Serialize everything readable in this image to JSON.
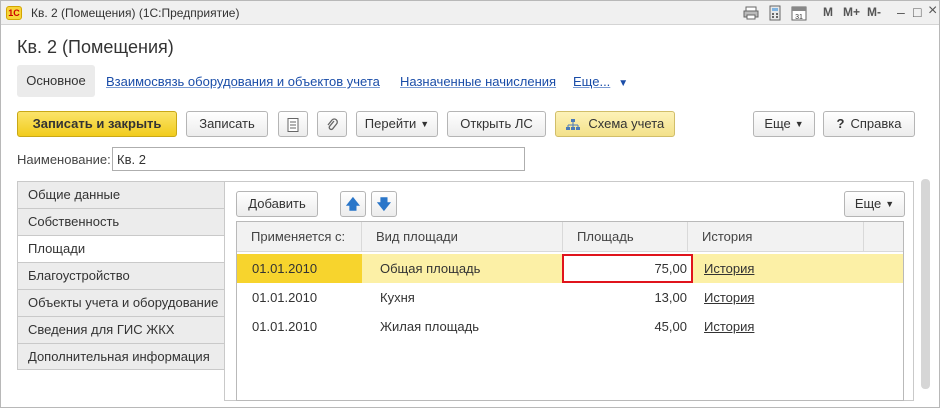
{
  "titlebar": {
    "app_logo": "1С",
    "title": "Кв. 2 (Помещения)  (1С:Предприятие)",
    "icons": [
      "print-icon",
      "calculator-icon",
      "calendar-icon"
    ],
    "calendar_day": "31",
    "m_label": "M",
    "mplus_label": "M+",
    "mminus_label": "M-",
    "minimize_glyph": "–",
    "maximize_glyph": "□",
    "close_glyph": "×"
  },
  "form": {
    "title": "Кв. 2 (Помещения)"
  },
  "nav": {
    "active": "Основное",
    "links": [
      "Взаимосвязь оборудования и объектов учета",
      "Назначенные начисления",
      "Еще..."
    ]
  },
  "toolbar": {
    "save_close": "Записать и закрыть",
    "save": "Записать",
    "goto": "Перейти",
    "open_ls": "Открыть ЛС",
    "scheme": "Схема учета",
    "more": "Еще",
    "help": "Справка"
  },
  "name_field": {
    "label": "Наименование:",
    "value": "Кв. 2"
  },
  "side_tabs": [
    "Общие данные",
    "Собственность",
    "Площади",
    "Благоустройство",
    "Объекты учета и оборудование",
    "Сведения для ГИС ЖКХ",
    "Дополнительная информация"
  ],
  "active_side_tab": 2,
  "table_toolbar": {
    "add": "Добавить",
    "more": "Еще"
  },
  "table": {
    "columns": [
      "Применяется с:",
      "Вид площади",
      "Площадь",
      "История"
    ],
    "rows": [
      {
        "date": "01.01.2010",
        "kind": "Общая площадь",
        "area": "75,00",
        "history": "История"
      },
      {
        "date": "01.01.2010",
        "kind": "Кухня",
        "area": "13,00",
        "history": "История"
      },
      {
        "date": "01.01.2010",
        "kind": "Жилая площадь",
        "area": "45,00",
        "history": "История"
      }
    ]
  },
  "colors": {
    "primary_button": "#f1cc1c",
    "selected_row": "#fcf0a6",
    "highlight_border": "#e0141c",
    "link": "#1a4da8"
  }
}
